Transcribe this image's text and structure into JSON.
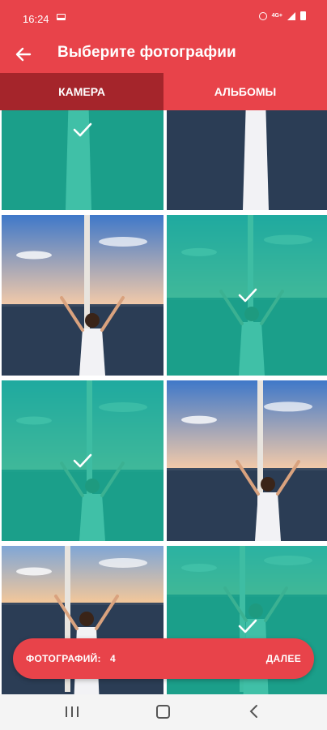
{
  "status_bar": {
    "time": "16:24",
    "icons": [
      "laptop-icon",
      "alarm-icon",
      "lte-icon",
      "signal-icon",
      "battery-icon"
    ],
    "lte_label": "4G+"
  },
  "app_bar": {
    "back_icon": "arrow-left-icon",
    "title": "Выберите фотографии"
  },
  "tabs": [
    {
      "label": "КАМЕРА",
      "selected": true
    },
    {
      "label": "АЛЬБОМЫ",
      "selected": false
    }
  ],
  "photos": [
    {
      "selected": true
    },
    {
      "selected": false
    },
    {
      "selected": false
    },
    {
      "selected": true
    },
    {
      "selected": true
    },
    {
      "selected": false
    },
    {
      "selected": false
    },
    {
      "selected": true
    }
  ],
  "selection_bar": {
    "count_label": "ФОТОГРАФИЙ:",
    "count_value": "4",
    "next_label": "ДАЛЕЕ"
  },
  "nav_bar": {
    "icons": [
      "recent-apps-icon",
      "home-icon",
      "back-icon"
    ]
  },
  "colors": {
    "primary": "#e8434a",
    "primary_dark": "#a5252b",
    "selection_overlay": "#18b496"
  }
}
